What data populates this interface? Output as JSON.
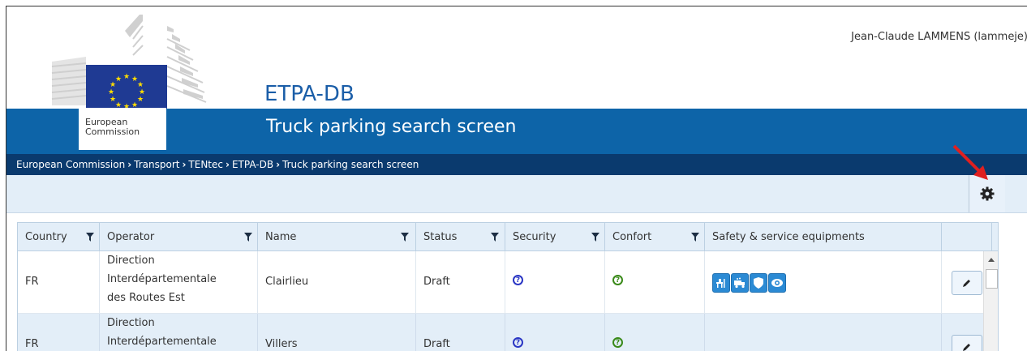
{
  "header": {
    "user": "Jean-Claude LAMMENS (lammeje)",
    "app_title": "ETPA-DB",
    "subtitle": "Truck parking search screen",
    "logo_line1": "European",
    "logo_line2": "Commission"
  },
  "breadcrumb": [
    "European Commission",
    "Transport",
    "TENtec",
    "ETPA-DB",
    "Truck parking search screen"
  ],
  "toolbar": {
    "settings_icon": "gear-icon"
  },
  "grid": {
    "columns": [
      "Country",
      "Operator",
      "Name",
      "Status",
      "Security",
      "Confort",
      "Safety & service equipments"
    ],
    "rows": [
      {
        "country": "FR",
        "operator_lines": [
          "Direction",
          "Interdépartementale",
          "des Routes Est"
        ],
        "name": "Clairlieu",
        "status": "Draft",
        "security": "?",
        "confort": "?",
        "equipments": [
          "restaurant-icon",
          "truck-wash-icon",
          "shield-icon",
          "eye-icon"
        ]
      },
      {
        "country": "FR",
        "operator_lines": [
          "Direction",
          "Interdépartementale"
        ],
        "name": "Villers",
        "status": "Draft",
        "security": "?",
        "confort": "?",
        "equipments": []
      }
    ]
  },
  "colors": {
    "banner": "#0d64a8",
    "breadcrumb_bar": "#0a3a6e",
    "title": "#1b5ea8",
    "header_bg": "#e3eef8",
    "arrow": "#e02020"
  }
}
